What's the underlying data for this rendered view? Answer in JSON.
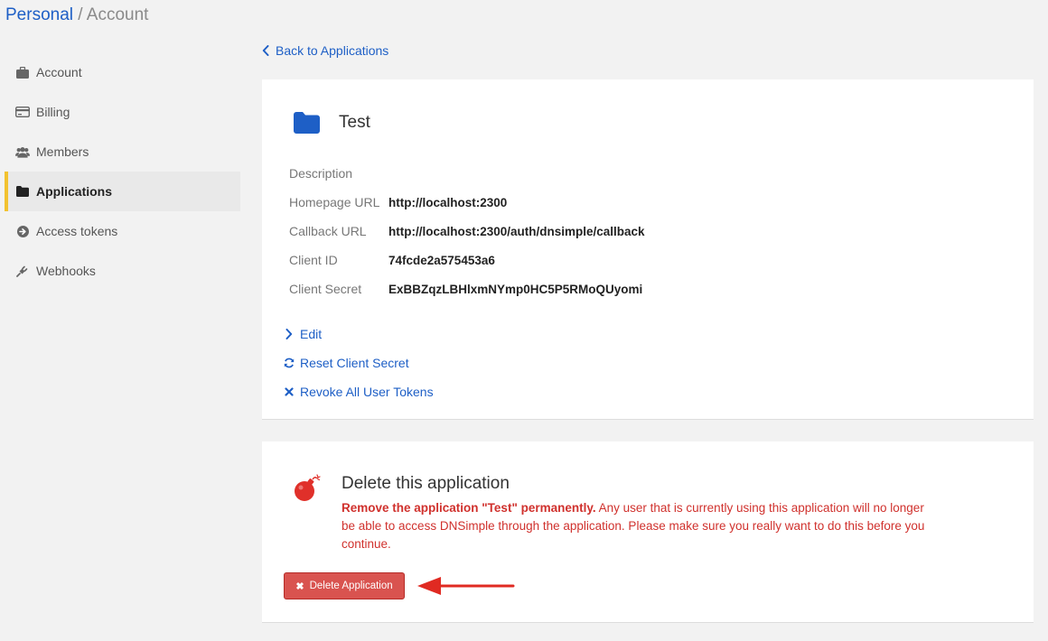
{
  "breadcrumb": {
    "first": "Personal",
    "separator": "/",
    "current": "Account"
  },
  "sidebar": {
    "items": [
      {
        "label": "Account",
        "icon": "briefcase-icon",
        "active": false
      },
      {
        "label": "Billing",
        "icon": "credit-card-icon",
        "active": false
      },
      {
        "label": "Members",
        "icon": "users-icon",
        "active": false
      },
      {
        "label": "Applications",
        "icon": "folder-icon",
        "active": true
      },
      {
        "label": "Access tokens",
        "icon": "arrow-circle-icon",
        "active": false
      },
      {
        "label": "Webhooks",
        "icon": "plug-icon",
        "active": false
      }
    ]
  },
  "back_link": {
    "label": "Back to Applications"
  },
  "application": {
    "name": "Test",
    "fields": [
      {
        "label": "Description",
        "value": ""
      },
      {
        "label": "Homepage URL",
        "value": "http://localhost:2300"
      },
      {
        "label": "Callback URL",
        "value": "http://localhost:2300/auth/dnsimple/callback"
      },
      {
        "label": "Client ID",
        "value": "74fcde2a575453a6"
      },
      {
        "label": "Client Secret",
        "value": "ExBBZqzLBHlxmNYmp0HC5P5RMoQUyomi"
      }
    ],
    "actions": [
      {
        "label": "Edit",
        "icon": "chevron-right-icon"
      },
      {
        "label": "Reset Client Secret",
        "icon": "refresh-icon"
      },
      {
        "label": "Revoke All User Tokens",
        "icon": "close-icon"
      }
    ]
  },
  "delete_section": {
    "title": "Delete this application",
    "warning_bold": "Remove the application \"Test\" permanently.",
    "warning_text": " Any user that is currently using this application will no longer be able to access DNSimple through the application. Please make sure you really want to do this before you continue.",
    "button_label": "Delete Application"
  },
  "colors": {
    "link": "#1e5fc6",
    "danger": "#d9534f",
    "warning_text": "#d0312d",
    "active_marker": "#f2c230"
  }
}
